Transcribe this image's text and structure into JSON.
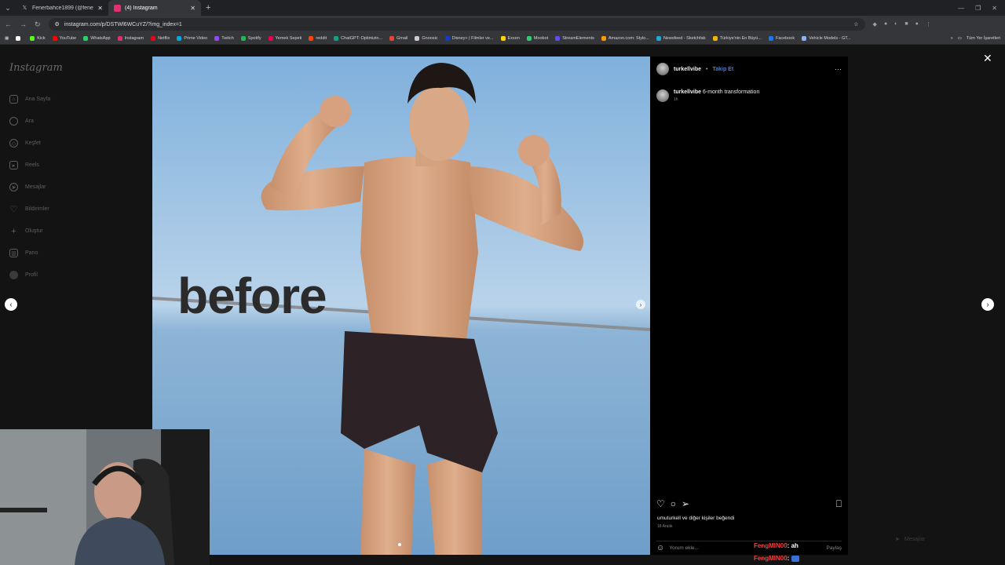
{
  "browser": {
    "tabs": [
      {
        "label": "Fenerbahce1899 (@fenerbahce",
        "icon": "x-logo-icon",
        "active": false
      },
      {
        "label": "(4) Instagram",
        "icon": "instagram-icon",
        "active": true
      }
    ],
    "url": "instagram.com/p/DSTWl6WCuYZ/?img_index=1",
    "bookmarks": [
      {
        "label": "",
        "icon": "x-logo-icon",
        "color": "#ffffff"
      },
      {
        "label": "Kick",
        "color": "#53fc18"
      },
      {
        "label": "YouTube",
        "color": "#ff0000"
      },
      {
        "label": "WhatsApp",
        "color": "#25d366"
      },
      {
        "label": "Instagram",
        "color": "#e1306c"
      },
      {
        "label": "Netflix",
        "color": "#e50914"
      },
      {
        "label": "Prime Video",
        "color": "#00a8e1"
      },
      {
        "label": "Twitch",
        "color": "#9146ff"
      },
      {
        "label": "Spotify",
        "color": "#1db954"
      },
      {
        "label": "Yemek Sepeti",
        "color": "#ea004b"
      },
      {
        "label": "reddit",
        "color": "#ff4500"
      },
      {
        "label": "ChatGPT: Optimizin...",
        "color": "#10a37f"
      },
      {
        "label": "Gmail",
        "color": "#ea4335"
      },
      {
        "label": "Gnoosic",
        "color": "#cccccc"
      },
      {
        "label": "Disney+ | Filmler ve...",
        "color": "#113ccf"
      },
      {
        "label": "Exxen",
        "color": "#ffd400"
      },
      {
        "label": "Moobot",
        "color": "#2ecc71"
      },
      {
        "label": "StreamElements",
        "color": "#5b4cf5"
      },
      {
        "label": "Amazon.com: Stylo...",
        "color": "#ff9900"
      },
      {
        "label": "Newsfeed - Sketchfab",
        "color": "#1caad9"
      },
      {
        "label": "Türkiye'nin En Büyü...",
        "color": "#f7b500"
      },
      {
        "label": "Facebook",
        "color": "#1877f2"
      },
      {
        "label": "Vehicle Models - GT...",
        "color": "#8ab4f8"
      }
    ],
    "bookmarks_more": "»",
    "all_bookmarks": "Tüm Yer İşaretleri"
  },
  "sidebar": {
    "logo": "Instagram",
    "items": [
      {
        "label": "Ana Sayfa",
        "icon": "home-icon"
      },
      {
        "label": "Ara",
        "icon": "search-icon"
      },
      {
        "label": "Keşfet",
        "icon": "compass-icon"
      },
      {
        "label": "Reels",
        "icon": "reels-icon"
      },
      {
        "label": "Mesajlar",
        "icon": "messenger-icon"
      },
      {
        "label": "Bildirimler",
        "icon": "heart-icon"
      },
      {
        "label": "Oluştur",
        "icon": "plus-icon"
      },
      {
        "label": "Pano",
        "icon": "dashboard-icon"
      },
      {
        "label": "Profil",
        "icon": "avatar-icon"
      }
    ]
  },
  "post": {
    "overlay_text": "before",
    "username": "turkellvibe",
    "separator": "•",
    "follow_label": "Takip Et",
    "more_label": "···",
    "caption_user": "turkellvibe",
    "caption_text": "6-month transformation",
    "caption_age": "1h",
    "likes_text": "umuturkell ve diğer kişiler beğendi",
    "date": "18 Aralık",
    "comment_placeholder": "Yorum ekle...",
    "share_label": "Paylaş"
  },
  "overlay": {
    "close": "✕",
    "prev": "‹",
    "next": "›",
    "messages_label": "Mesajlar"
  },
  "chat": [
    {
      "user": "FengMIN00",
      "sep": ":",
      "message": "ah"
    },
    {
      "user": "FengMIN00",
      "sep": ":",
      "message": ""
    }
  ],
  "colors": {
    "follow_blue": "#4f7bd8",
    "chat_user_red": "#ff3b3b"
  }
}
